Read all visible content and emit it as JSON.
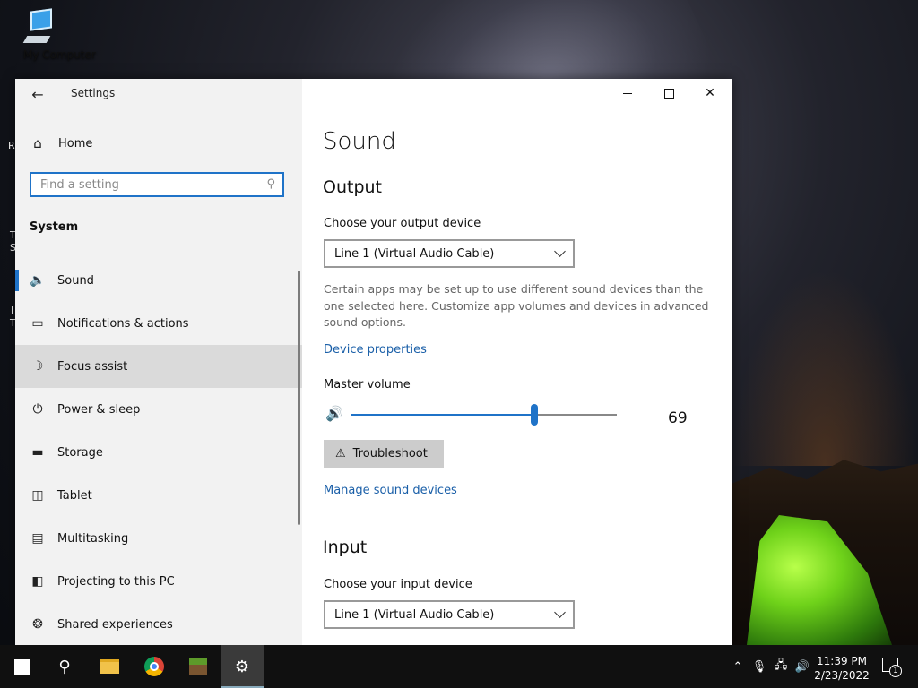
{
  "desktop": {
    "icon_label": "My Computer",
    "edge_letters": [
      "R",
      "T",
      "S",
      "I",
      "T"
    ]
  },
  "window": {
    "app_title": "Settings",
    "back_icon": "back-arrow-icon"
  },
  "sidebar": {
    "home_label": "Home",
    "search_placeholder": "Find a setting",
    "section_label": "System",
    "items": [
      {
        "label": "Sound",
        "icon": "speaker-icon"
      },
      {
        "label": "Notifications & actions",
        "icon": "notification-icon"
      },
      {
        "label": "Focus assist",
        "icon": "moon-icon"
      },
      {
        "label": "Power & sleep",
        "icon": "power-icon"
      },
      {
        "label": "Storage",
        "icon": "storage-icon"
      },
      {
        "label": "Tablet",
        "icon": "tablet-icon"
      },
      {
        "label": "Multitasking",
        "icon": "multitasking-icon"
      },
      {
        "label": "Projecting to this PC",
        "icon": "projecting-icon"
      },
      {
        "label": "Shared experiences",
        "icon": "shared-icon"
      }
    ],
    "active_index": 0,
    "hover_index": 2
  },
  "main": {
    "page_title": "Sound",
    "output": {
      "heading": "Output",
      "device_label": "Choose your output device",
      "device_value": "Line 1 (Virtual Audio Cable)",
      "description": "Certain apps may be set up to use different sound devices than the one selected here. Customize app volumes and devices in advanced sound options.",
      "device_properties_link": "Device properties",
      "master_volume_label": "Master volume",
      "volume": 69,
      "troubleshoot_label": "Troubleshoot",
      "manage_link": "Manage sound devices"
    },
    "input": {
      "heading": "Input",
      "device_label": "Choose your input device",
      "device_value": "Line 1 (Virtual Audio Cable)"
    }
  },
  "taskbar": {
    "time": "11:39 PM",
    "date": "2/23/2022",
    "notification_count": "1",
    "accent_color": "#1f73c8"
  }
}
